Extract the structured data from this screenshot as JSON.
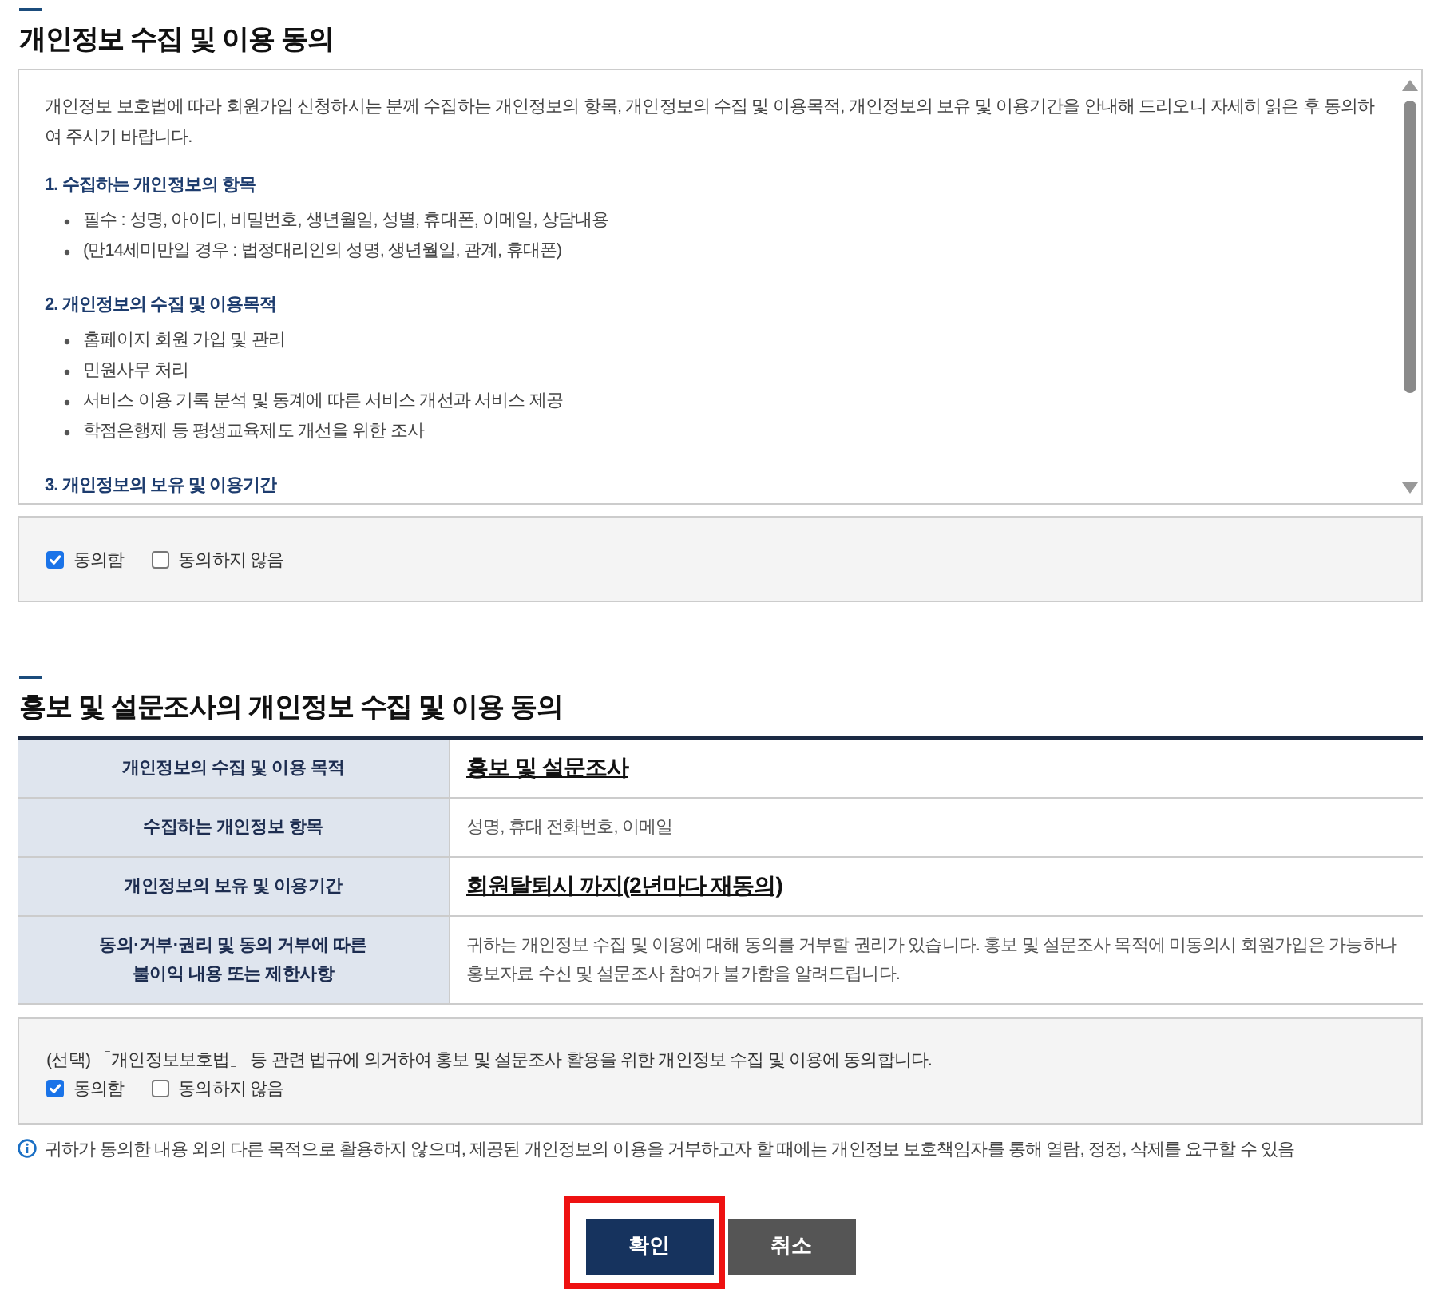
{
  "section_1": {
    "title": "개인정보 수집 및 이용 동의",
    "intro": "개인정보 보호법에 따라 회원가입 신청하시는 분께 수집하는 개인정보의 항목, 개인정보의 수집 및 이용목적, 개인정보의 보유 및 이용기간을 안내해 드리오니 자세히 읽은 후 동의하여 주시기 바랍니다.",
    "groups": [
      {
        "heading": "1. 수집하는 개인정보의 항목",
        "items": [
          "필수 : 성명, 아이디, 비밀번호, 생년월일, 성별, 휴대폰, 이메일, 상담내용",
          "(만14세미만일 경우 : 법정대리인의 성명, 생년월일, 관계, 휴대폰)"
        ]
      },
      {
        "heading": "2. 개인정보의 수집 및 이용목적",
        "items": [
          "홈페이지 회원 가입 및 관리",
          "민원사무 처리",
          "서비스 이용 기록 분석 및 동계에 따른 서비스 개선과 서비스 제공",
          "학점은행제 등 평생교육제도 개선을 위한 조사"
        ]
      },
      {
        "heading": "3. 개인정보의 보유 및 이용기간"
      }
    ],
    "consent": {
      "options": [
        {
          "label": "동의함",
          "checked": true
        },
        {
          "label": "동의하지 않음",
          "checked": false
        }
      ]
    }
  },
  "section_2": {
    "title": "홍보 및 설문조사의 개인정보 수집 및 이용 동의",
    "table": {
      "rows": [
        {
          "header": "개인정보의 수집 및 이용 목적",
          "value": "홍보 및 설문조사",
          "kind": "emphasis"
        },
        {
          "header": "수집하는 개인정보 항목",
          "value": "성명, 휴대 전화번호, 이메일",
          "kind": "plain"
        },
        {
          "header": "개인정보의 보유 및 이용기간",
          "value": "회원탈퇴시 까지(2년마다 재동의)",
          "kind": "emphasis"
        },
        {
          "header": "동의·거부·권리 및 동의 거부에 따른\n불이익 내용 또는 제한사항",
          "value": "귀하는 개인정보 수집 및 이용에 대해 동의를 거부할 권리가 있습니다. 홍보 및 설문조사 목적에 미동의시 회원가입은 가능하나 홍보자료 수신 및 설문조사 참여가 불가함을 알려드립니다.",
          "kind": "plain"
        }
      ]
    },
    "consent": {
      "statement": "(선택) 「개인정보보호법」 등 관련 법규에 의거하여 홍보 및 설문조사 활용을 위한 개인정보 수집 및 이용에 동의합니다.",
      "options": [
        {
          "label": "동의함",
          "checked": true
        },
        {
          "label": "동의하지 않음",
          "checked": false
        }
      ]
    }
  },
  "notice": {
    "text": "귀하가 동의한 내용 외의 다른 목적으로 활용하지 않으며, 제공된 개인정보의 이용을 거부하고자 할 때에는 개인정보 보호책임자를 통해 열람, 정정, 삭제를 요구할 수 있음"
  },
  "buttons": [
    {
      "label": "확인",
      "kind": "primary",
      "highlighted": true
    },
    {
      "label": "취소",
      "kind": "secondary",
      "highlighted": false
    }
  ]
}
